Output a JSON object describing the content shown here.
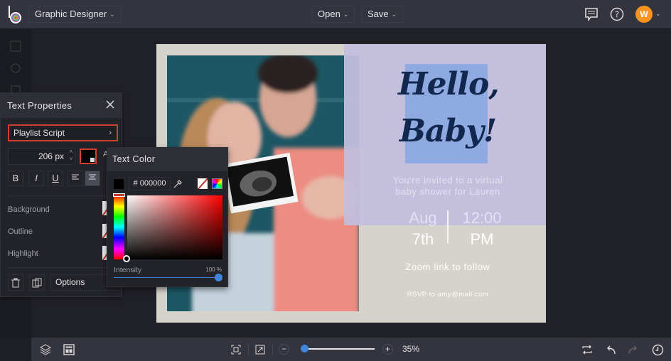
{
  "topbar": {
    "workspace_label": "Graphic Designer",
    "open_label": "Open",
    "save_label": "Save",
    "avatar_initial": "W",
    "icons": [
      "comment-icon",
      "help-icon"
    ]
  },
  "text_properties": {
    "title": "Text Properties",
    "font_name": "Playlist Script",
    "font_size": "206",
    "font_size_unit": "px",
    "text_color": "#000000",
    "format_buttons": [
      "B",
      "I",
      "U"
    ],
    "align_active": "center",
    "background_label": "Background",
    "outline_label": "Outline",
    "highlight_label": "Highlight",
    "options_label": "Options"
  },
  "text_color": {
    "title": "Text Color",
    "hex_prefix": "#",
    "hex_value": "000000",
    "intensity_label": "Intensity",
    "intensity_value": "100 %",
    "intensity_fraction": 1.0
  },
  "canvas": {
    "headline_line1": "Hello,",
    "headline_line2": "Baby!",
    "invite_line1": "You're invited to a virtual",
    "invite_line2": "baby shower for Lauren",
    "date_month": "Aug",
    "date_day": "7th",
    "time": "12:00",
    "time_period": "PM",
    "zoom_link": "Zoom link to follow",
    "rsvp": "RSVP to amy@mail.com"
  },
  "bottombar": {
    "zoom_percent": "35%",
    "zoom_fraction": 0.05
  },
  "colors": {
    "accent": "#3f86dc",
    "selection_border": "#d0402c",
    "avatar": "#f7931e"
  }
}
